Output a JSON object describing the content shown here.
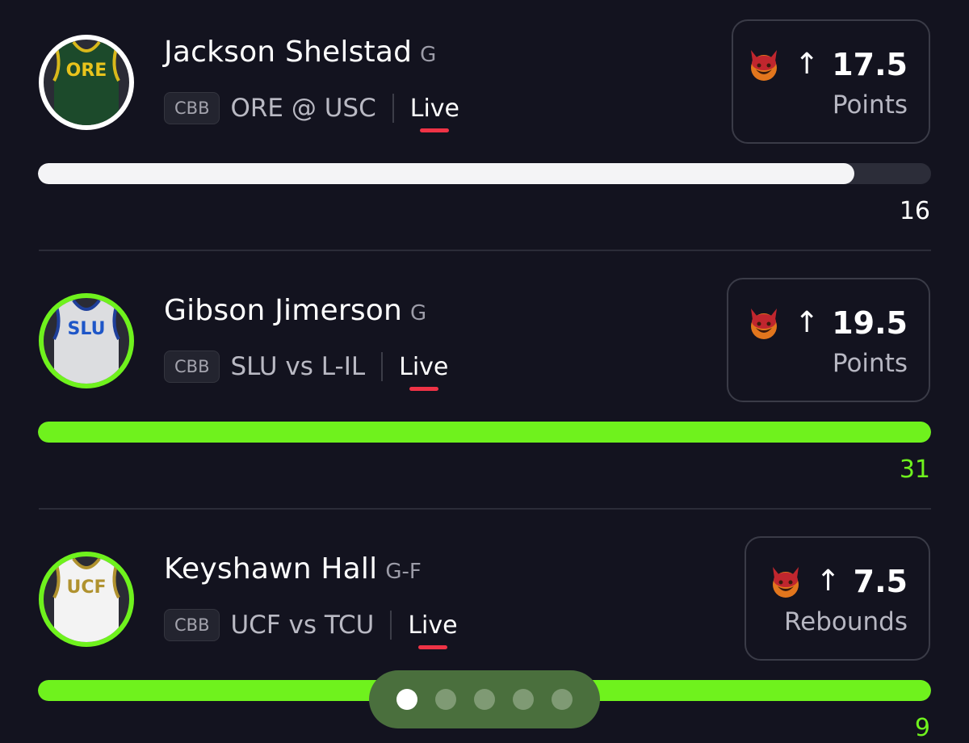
{
  "players": [
    {
      "name": "Jackson Shelstad",
      "position": "G",
      "league": "CBB",
      "matchup": "ORE @ USC",
      "status": "Live",
      "projection": "17.5",
      "stat_type": "Points",
      "current_value": "16",
      "progress_fraction": 0.914,
      "bar_color": "#f4f4f6",
      "value_color": "#ffffff",
      "ring_color": "#ffffff",
      "jersey_text": "ORE",
      "jersey_color": "#1c4a2b",
      "jersey_text_color": "#e8c31c",
      "jersey_trim_color": "#d9b81b",
      "icon": "demon-icon"
    },
    {
      "name": "Gibson Jimerson",
      "position": "G",
      "league": "CBB",
      "matchup": "SLU vs L-IL",
      "status": "Live",
      "projection": "19.5",
      "stat_type": "Points",
      "current_value": "31",
      "progress_fraction": 1.0,
      "bar_color": "#6ff21d",
      "value_color": "#6ff21d",
      "ring_color": "#6ff21d",
      "jersey_text": "SLU",
      "jersey_color": "#dcdde0",
      "jersey_text_color": "#1e56c8",
      "jersey_trim_color": "#1e3f9a",
      "icon": "demon-icon"
    },
    {
      "name": "Keyshawn Hall",
      "position": "G-F",
      "league": "CBB",
      "matchup": "UCF vs TCU",
      "status": "Live",
      "projection": "7.5",
      "stat_type": "Rebounds",
      "current_value": "9",
      "progress_fraction": 1.0,
      "bar_color": "#6ff21d",
      "value_color": "#6ff21d",
      "ring_color": "#6ff21d",
      "jersey_text": "UCF",
      "jersey_color": "#f3f3f3",
      "jersey_text_color": "#b0922f",
      "jersey_trim_color": "#b0922f",
      "icon": "demon-icon"
    }
  ],
  "pager": {
    "count": 5,
    "active_index": 0
  },
  "colors": {
    "background": "#13131f",
    "live_underline": "#ef3346",
    "hit_green": "#6ff21d",
    "pager_bg": "#4a6f3d"
  }
}
